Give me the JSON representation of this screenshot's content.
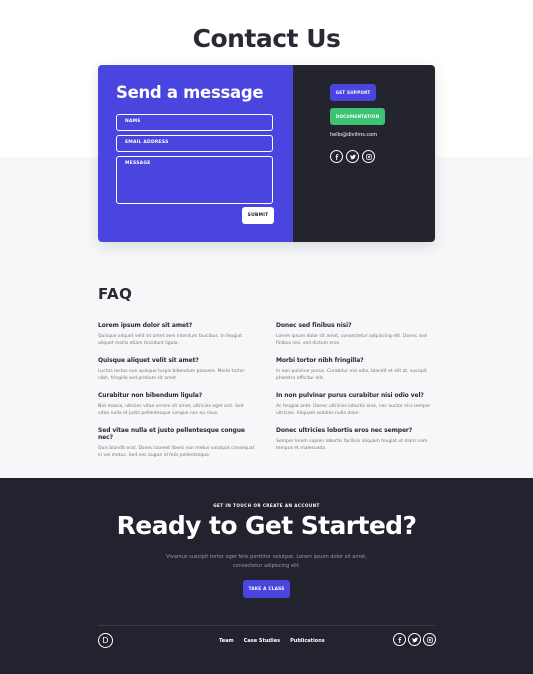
{
  "page": {
    "title": "Contact Us"
  },
  "form": {
    "title": "Send a message",
    "name_placeholder": "NAME",
    "email_placeholder": "EMAIL ADDRESS",
    "message_placeholder": "MESSAGE",
    "submit_label": "SUBMIT"
  },
  "support": {
    "support_label": "GET SUPPORT",
    "docs_label": "DOCUMENTATION",
    "email": "hello@divilms.com",
    "social_icons": [
      "facebook-icon",
      "twitter-icon",
      "instagram-icon"
    ]
  },
  "faq": {
    "title": "FAQ",
    "items": [
      {
        "q": "Lorem ipsum dolor sit amet?",
        "a": "Quisque aliquet velit sit amet sem interdum faucibus. In feugiat aliquet mollis etiam tincidunt ligula."
      },
      {
        "q": "Donec sed finibus nisi?",
        "a": "Lorem ipsum dolor sit amet, consectetur adipiscing elit. Donec sed finibus nisi, sed dictum eros."
      },
      {
        "q": "Quisque aliquet velit sit amet?",
        "a": "Luctus lectus non quisque turpis bibendum posuere. Morbi tortor nibh, fringilla sed pretium sit amet."
      },
      {
        "q": "Morbi tortor nibh fringilla?",
        "a": "In non pulvinar purus. Curabitur nisi odio, blandit et elit at, suscipit pharetra efficitur elit."
      },
      {
        "q": "Curabitur non bibendum ligula?",
        "a": "Nisl massa, ultrices vitae ornare sit amet, ultricies eget orci. Sed vitae nulla et justo pellentesque congue nec eu risus."
      },
      {
        "q": "In non pulvinar purus curabitur nisi odio vel?",
        "a": "Ac feugiat ante. Donec ultricies lobortis eros, nec auctor nisl semper ultricies. Aliquam sodales nulla dolor."
      },
      {
        "q": "Sed vitae nulla et justo pellentesque congue nec?",
        "a": "Quis blandit erat. Donec laoreet libero non metus volutpat consequat in vel metus. Sed nec augue id felis pellentesque."
      },
      {
        "q": "Donec ultricies lobortis eros nec semper?",
        "a": "Semper lorem sapien lobortis facilisis aliquam feugiat ut diam nam tempus et malesuada."
      }
    ]
  },
  "cta": {
    "eyebrow": "GET IN TOUCH OR CREATE AN ACCOUNT",
    "title": "Ready to Get Started?",
    "text": "Vivamus suscipit tortor eget felis porttitor volutpat. Lorem ipsum dolor sit amet, consectetur adipiscing elit.",
    "button_label": "TAKE A CLASS"
  },
  "footer": {
    "logo_letter": "D",
    "links": [
      "Team",
      "Case Studies",
      "Publications"
    ],
    "social_icons": [
      "facebook-icon",
      "twitter-icon",
      "instagram-icon"
    ]
  },
  "colors": {
    "accent": "#4a45de",
    "success": "#3cc274",
    "dark": "#22232e"
  }
}
